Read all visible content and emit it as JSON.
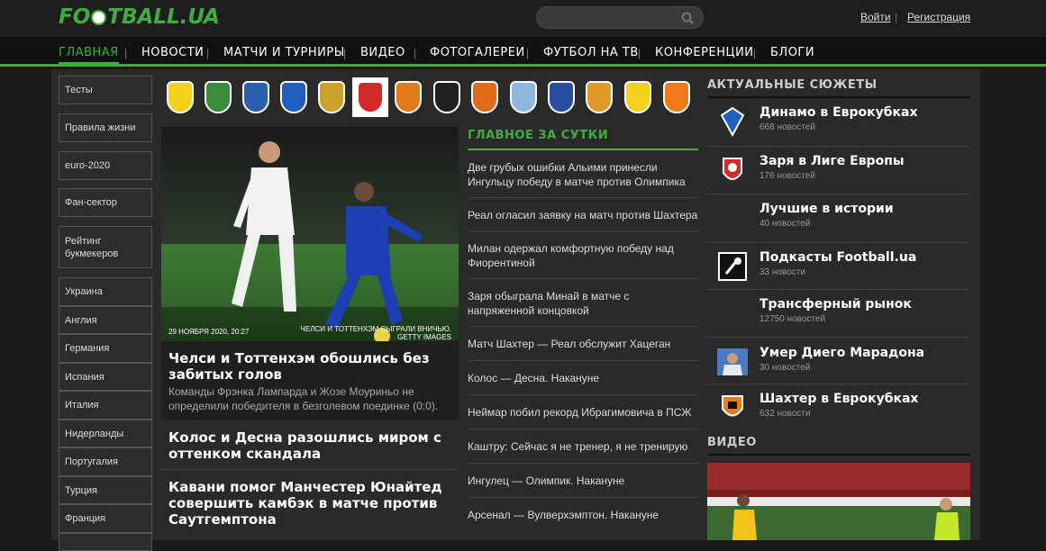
{
  "header": {
    "logo": "FOOTBALL.UA",
    "logo_parts": [
      "FO",
      "TBALL.UA"
    ],
    "search_placeholder": "",
    "login": "Войти",
    "separator": "|",
    "register": "Регистрация"
  },
  "nav": {
    "items": [
      "ГЛАВНАЯ",
      "НОВОСТИ",
      "МАТЧИ И ТУРНИРЫ",
      "ВИДЕО",
      "ФОТОГАЛЕРЕИ",
      "ФУТБОЛ НА ТВ",
      "КОНФЕРЕНЦИИ",
      "БЛОГИ"
    ],
    "active_index": 0,
    "accent": "#3fae3f"
  },
  "sidebar": {
    "items": [
      "Тесты",
      "Правила жизни",
      "euro-2020",
      "Фан-сектор",
      "Рейтинг букмекеров",
      "Украина",
      "Англия",
      "Германия",
      "Испания",
      "Италия",
      "Нидерланды",
      "Португалия",
      "Турция",
      "Франция"
    ]
  },
  "clubs": [
    {
      "icon": "oleksandria-crest-icon",
      "color": "#f2d21b"
    },
    {
      "icon": "vorskla-crest-icon",
      "color": "#3a8c3a"
    },
    {
      "icon": "desna-crest-icon",
      "color": "#2a5fb0"
    },
    {
      "icon": "dynamo-crest-icon",
      "color": "#1f5fbf"
    },
    {
      "icon": "dnipro-1-crest-icon",
      "color": "#c9a227"
    },
    {
      "icon": "zorya-crest-icon",
      "color": "#d42a2a"
    },
    {
      "icon": "inhulets-crest-icon",
      "color": "#e07a1a"
    },
    {
      "icon": "kolos-crest-icon",
      "color": "#222222"
    },
    {
      "icon": "mariupol-crest-icon",
      "color": "#e06a1a"
    },
    {
      "icon": "mynai-crest-icon",
      "color": "#8fb8e0"
    },
    {
      "icon": "olimpik-crest-icon",
      "color": "#2a4fa0"
    },
    {
      "icon": "rukh-crest-icon",
      "color": "#e09a2a"
    },
    {
      "icon": "rukh-lviv-crest-icon",
      "color": "#f2d21b"
    },
    {
      "icon": "shakhtar-crest-icon",
      "color": "#f07a1a"
    }
  ],
  "feature": {
    "date": "29 НОЯБРЯ 2020, 20:27",
    "credit": "ЧЕЛСИ И ТОТТЕНХЭМ СЫГРАЛИ ВНИЧЬЮ. GETTY IMAGES",
    "headline": "Челси и Тоттенхэм обошлись без забитых голов",
    "lead": "Команды Фрэнка Лампарда и Жозе Моуриньо не определили победителя в безголевом поединке (0:0)."
  },
  "sub_news": [
    "Колос и Десна разошлись миром с оттенком скандала",
    "Кавани помог Манчестер Юнайтед совершить камбэк в матче против Саутгемптона"
  ],
  "day_news": {
    "title": "ГЛАВНОЕ ЗА СУТКИ",
    "items": [
      "Две грубых ошибки Альими принесли Ингульцу победу в матче против Олимпика",
      "Реал огласил заявку на матч против Шахтера",
      "Милан одержал комфортную победу над Фиорентиной",
      "Заря обыграла Минай в матче с напряженной концовкой",
      "Матч Шахтер — Реал обслужит Хацеган",
      "Колос — Десна. Накануне",
      "Неймар побил рекорд Ибрагимовича в ПСЖ",
      "Каштру: Сейчас я не тренер, я не тренирую",
      "Ингулец — Олимпик. Накануне",
      "Арсенал — Вулверхэмптон. Накануне"
    ]
  },
  "topics": {
    "title": "АКТУАЛЬНЫЕ СЮЖЕТЫ",
    "items": [
      {
        "name": "Динамо в Еврокубках",
        "count": "668 новостей",
        "icon": "dynamo-crest-icon"
      },
      {
        "name": "Заря в Лиге Европы",
        "count": "176 новостей",
        "icon": "zorya-crest-icon"
      },
      {
        "name": "Лучшие в истории",
        "count": "40 новостей",
        "icon": ""
      },
      {
        "name": "Подкасты Football.ua",
        "count": "33 новости",
        "icon": "podcast-icon"
      },
      {
        "name": "Трансферный рынок",
        "count": "12750 новостей",
        "icon": ""
      },
      {
        "name": "Умер Диего Марадона",
        "count": "30 новостей",
        "icon": "maradona-photo-icon"
      },
      {
        "name": "Шахтер в Еврокубках",
        "count": "632 новости",
        "icon": "shakhtar-crest-icon"
      }
    ]
  },
  "video": {
    "title": "ВИДЕО"
  }
}
